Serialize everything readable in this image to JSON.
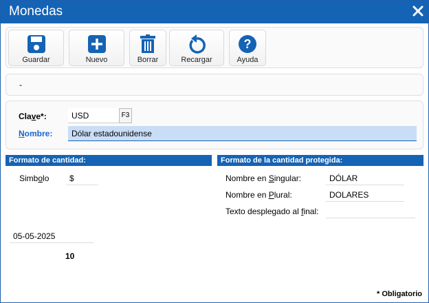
{
  "window": {
    "title": "Monedas"
  },
  "toolbar": {
    "buttons": [
      {
        "label": "Guardar",
        "icon": "save-icon"
      },
      {
        "label": "Nuevo",
        "icon": "plus-icon"
      },
      {
        "label": "Borrar",
        "icon": "trash-icon"
      },
      {
        "label": "Recargar",
        "icon": "reload-icon"
      },
      {
        "label": "Ayuda",
        "icon": "help-icon"
      }
    ]
  },
  "status": {
    "text": "-"
  },
  "form": {
    "clave_label_a": "Cla",
    "clave_label_u": "v",
    "clave_label_b": "e*:",
    "clave_value": "USD",
    "f3_label": "F3",
    "nombre_label_u": "N",
    "nombre_label_b": "ombre:",
    "nombre_value": "Dólar estadounidense"
  },
  "formato_cantidad": {
    "header": "Formato de cantidad:",
    "simbolo_label_a": "Simb",
    "simbolo_label_u": "o",
    "simbolo_label_b": "lo",
    "simbolo_value": "$",
    "date_value": "05-05-2025",
    "count_value": "10"
  },
  "formato_protegida": {
    "header": "Formato de la cantidad protegida:",
    "singular_label_a": "Nombre en ",
    "singular_label_u": "S",
    "singular_label_b": "ingular:",
    "singular_value": "DÓLAR",
    "plural_label_a": "Nombre en ",
    "plural_label_u": "P",
    "plural_label_b": "lural:",
    "plural_value": "DOLARES",
    "texto_label_a": "Texto desplegado al ",
    "texto_label_u": "f",
    "texto_label_b": "inal:",
    "texto_value": ""
  },
  "footer": {
    "obligatorio": "* Obligatorio"
  },
  "colors": {
    "accent": "#1563b5",
    "selected_field": "#c9ddf7",
    "label_blue": "#1a64c8"
  }
}
